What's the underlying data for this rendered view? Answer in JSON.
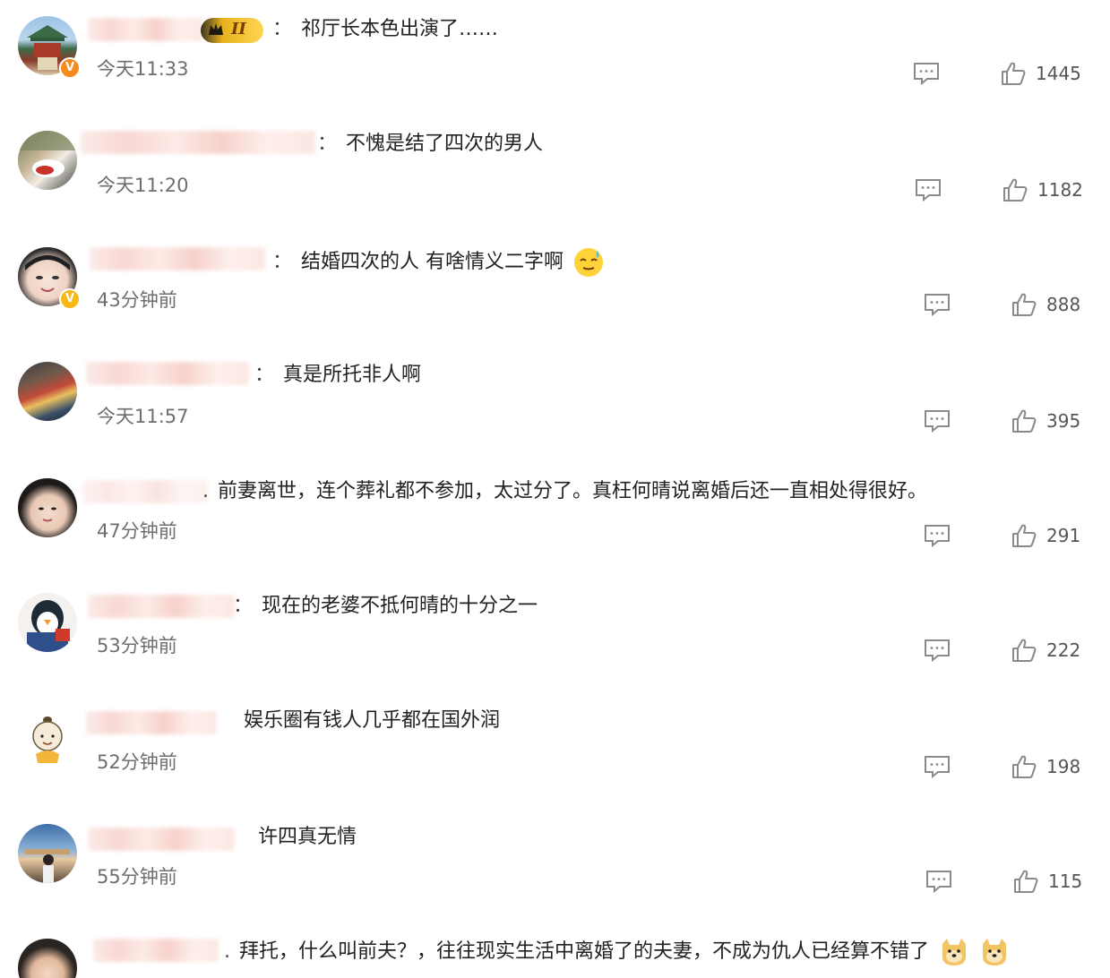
{
  "comments": [
    {
      "text": "祁厅长本色出演了……",
      "time": "今天11:33",
      "likes": "1445"
    },
    {
      "text": "不愧是结了四次的男人",
      "time": "今天11:20",
      "likes": "1182"
    },
    {
      "text": "结婚四次的人 有啥情义二字啊",
      "time": "43分钟前",
      "likes": "888"
    },
    {
      "text": "真是所托非人啊",
      "time": "今天11:57",
      "likes": "395"
    },
    {
      "text": "前妻离世，连个葬礼都不参加，太过分了。真枉何晴说离婚后还一直相处得很好。",
      "time": "47分钟前",
      "likes": "291"
    },
    {
      "text": "现在的老婆不抵何晴的十分之一",
      "time": "53分钟前",
      "likes": "222"
    },
    {
      "text": "娱乐圈有钱人几乎都在国外润",
      "time": "52分钟前",
      "likes": "198"
    },
    {
      "text": "许四真无情",
      "time": "55分钟前",
      "likes": "115"
    },
    {
      "text": "拜托，什么叫前夫？，往往现实生活中离婚了的夫妻，不成为仇人已经算不错了",
      "time": "",
      "likes": ""
    }
  ],
  "separators": {
    "colon": "：",
    "dot": "."
  },
  "badges": {
    "level": "II",
    "verified": "V"
  },
  "colors": {
    "orange_verify": "#f58a1f",
    "gold_verify": "#f6b917",
    "text": "#222222",
    "meta": "#6e6e6e"
  },
  "icons": {
    "reply": "comment-bubble-icon",
    "like": "thumbs-up-icon"
  }
}
